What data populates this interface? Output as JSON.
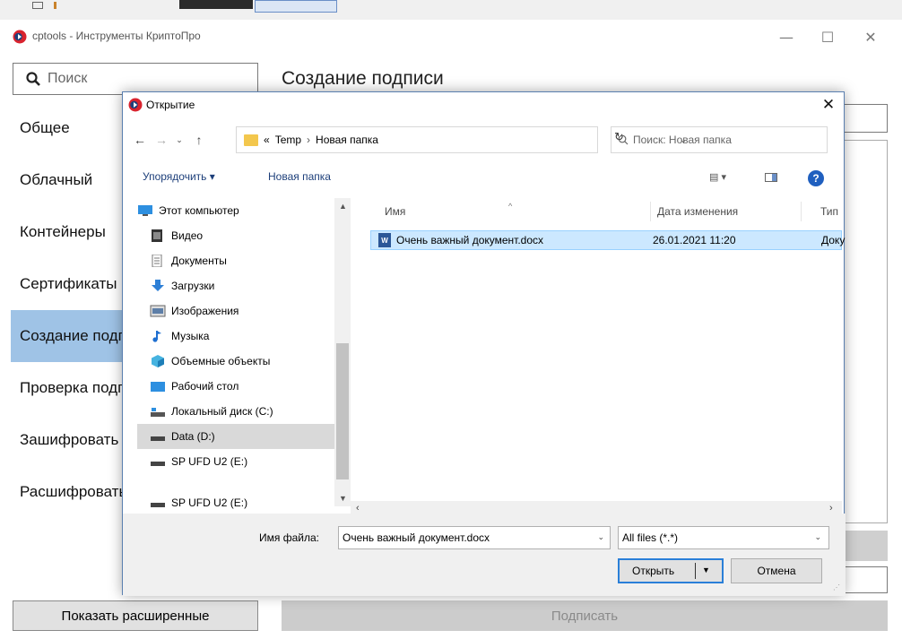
{
  "app": {
    "title": "cptools - Инструменты КриптоПро",
    "minimize": "—",
    "maximize": "☐",
    "close": "✕"
  },
  "search": {
    "placeholder": "Поиск"
  },
  "sidebar": {
    "items": [
      {
        "label": "Общее",
        "active": false
      },
      {
        "label": "Облачный",
        "active": false
      },
      {
        "label": "Контейнеры",
        "active": false
      },
      {
        "label": "Сертификаты",
        "active": false
      },
      {
        "label": "Создание подписи",
        "active": true
      },
      {
        "label": "Проверка подписи",
        "active": false
      },
      {
        "label": "Зашифровать",
        "active": false
      },
      {
        "label": "Расшифровать",
        "active": false
      }
    ],
    "show_advanced": "Показать расширенные"
  },
  "main": {
    "heading": "Создание подписи",
    "sign_button": "Подписать"
  },
  "dialog": {
    "title": "Открытие",
    "close": "✕",
    "nav": {
      "back": "←",
      "forward": "→",
      "recent": "⌄",
      "up": "↑"
    },
    "address": {
      "prefix": "«",
      "crumbs": [
        "Temp",
        "Новая папка"
      ],
      "separator": "›",
      "refresh": "↻"
    },
    "search_placeholder": "Поиск: Новая папка",
    "toolbar": {
      "organize": "Упорядочить ▾",
      "new_folder": "Новая папка",
      "view": "▤ ▾",
      "help": "?"
    },
    "nav_pane": {
      "items": [
        {
          "label": "Этот компьютер",
          "icon": "computer-icon",
          "level": 0,
          "selected": false
        },
        {
          "label": "Видео",
          "icon": "video-icon",
          "level": 1,
          "selected": false
        },
        {
          "label": "Документы",
          "icon": "documents-icon",
          "level": 1,
          "selected": false
        },
        {
          "label": "Загрузки",
          "icon": "downloads-icon",
          "level": 1,
          "selected": false
        },
        {
          "label": "Изображения",
          "icon": "pictures-icon",
          "level": 1,
          "selected": false
        },
        {
          "label": "Музыка",
          "icon": "music-icon",
          "level": 1,
          "selected": false
        },
        {
          "label": "Объемные объекты",
          "icon": "3d-objects-icon",
          "level": 1,
          "selected": false
        },
        {
          "label": "Рабочий стол",
          "icon": "desktop-icon",
          "level": 1,
          "selected": false
        },
        {
          "label": "Локальный диск (C:)",
          "icon": "local-disk-icon",
          "level": 1,
          "selected": false
        },
        {
          "label": "Data (D:)",
          "icon": "drive-icon",
          "level": 1,
          "selected": true
        },
        {
          "label": "SP UFD U2 (E:)",
          "icon": "drive-icon",
          "level": 1,
          "selected": false
        },
        {
          "label": "SP UFD U2 (E:)",
          "icon": "drive-icon",
          "level": 1,
          "selected": false
        }
      ]
    },
    "columns": {
      "name": "Имя",
      "date": "Дата изменения",
      "type": "Тип"
    },
    "files": [
      {
        "name": "Очень важный документ.docx",
        "date": "26.01.2021 11:20",
        "type": "Доку",
        "selected": true
      }
    ],
    "filename_label": "Имя файла:",
    "filename_value": "Очень важный документ.docx",
    "filetype_value": "All files (*.*)",
    "open_button": "Открыть",
    "cancel_button": "Отмена"
  },
  "colors": {
    "sidebar_active": "#9fc3e6",
    "selection": "#cce8ff",
    "accent": "#2a7fd8"
  }
}
